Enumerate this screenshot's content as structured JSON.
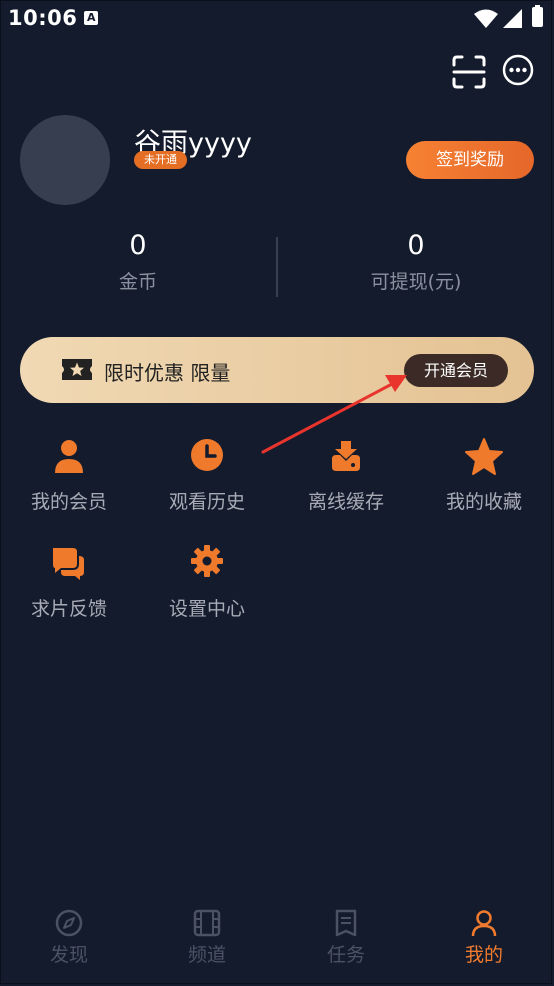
{
  "status_bar": {
    "time": "10:06",
    "notification_letter": "A"
  },
  "profile": {
    "username": "谷雨yyyy",
    "vip_tag": "未开通",
    "checkin_label": "签到奖励"
  },
  "stats": {
    "coins_value": "0",
    "coins_label": "金币",
    "withdraw_value": "0",
    "withdraw_label": "可提现(元)"
  },
  "promo": {
    "text": "限时优惠 限量",
    "button_label": "开通会员"
  },
  "features": [
    {
      "label": "我的会员",
      "icon": "user-icon"
    },
    {
      "label": "观看历史",
      "icon": "clock-icon"
    },
    {
      "label": "离线缓存",
      "icon": "download-icon"
    },
    {
      "label": "我的收藏",
      "icon": "star-icon"
    },
    {
      "label": "求片反馈",
      "icon": "chat-icon"
    },
    {
      "label": "设置中心",
      "icon": "gear-icon"
    }
  ],
  "bottom_nav": [
    {
      "label": "发现",
      "icon": "compass-icon",
      "active": false
    },
    {
      "label": "频道",
      "icon": "film-icon",
      "active": false
    },
    {
      "label": "任务",
      "icon": "task-icon",
      "active": false
    },
    {
      "label": "我的",
      "icon": "person-icon",
      "active": true
    }
  ],
  "colors": {
    "background": "#141b2d",
    "accent": "#f07b2e",
    "promo_gold": "#e4c293"
  }
}
